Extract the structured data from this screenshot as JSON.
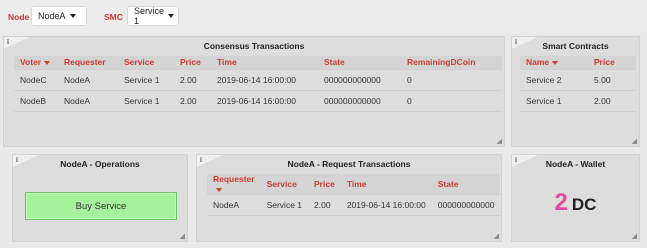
{
  "topbar": {
    "node_label": "Node",
    "node_value": "NodeA",
    "smc_label": "SMC",
    "smc_value": "Service 1"
  },
  "consensus": {
    "title": "Consensus Transactions",
    "headers": [
      "Voter",
      "Requester",
      "Service",
      "Price",
      "Time",
      "State",
      "RemainingDCoin"
    ],
    "rows": [
      [
        "NodeC",
        "NodeA",
        "Service 1",
        "2.00",
        "2019-06-14 16:00:00",
        "000000000000",
        "0"
      ],
      [
        "NodeB",
        "NodeA",
        "Service 1",
        "2.00",
        "2019-06-14 16:00:00",
        "000000000000",
        "0"
      ]
    ]
  },
  "smart_contracts": {
    "title": "Smart Contracts",
    "headers": [
      "Name",
      "Price"
    ],
    "rows": [
      [
        "Service 2",
        "5.00"
      ],
      [
        "Service 1",
        "2.00"
      ]
    ]
  },
  "operations": {
    "title": "NodeA - Operations",
    "buy_label": "Buy Service"
  },
  "requests": {
    "title": "NodeA - Request Transactions",
    "headers": [
      "Requester",
      "Service",
      "Price",
      "Time",
      "State"
    ],
    "rows": [
      [
        "NodeA",
        "Service 1",
        "2.00",
        "2019-06-14 16:00:00",
        "000000000000"
      ]
    ]
  },
  "wallet": {
    "title": "NodeA - Wallet",
    "amount": "2",
    "unit": "DC"
  },
  "colors": {
    "accent_red": "#d03a2f",
    "button_green": "#a6f29c",
    "wallet_pink": "#e04aa0"
  }
}
